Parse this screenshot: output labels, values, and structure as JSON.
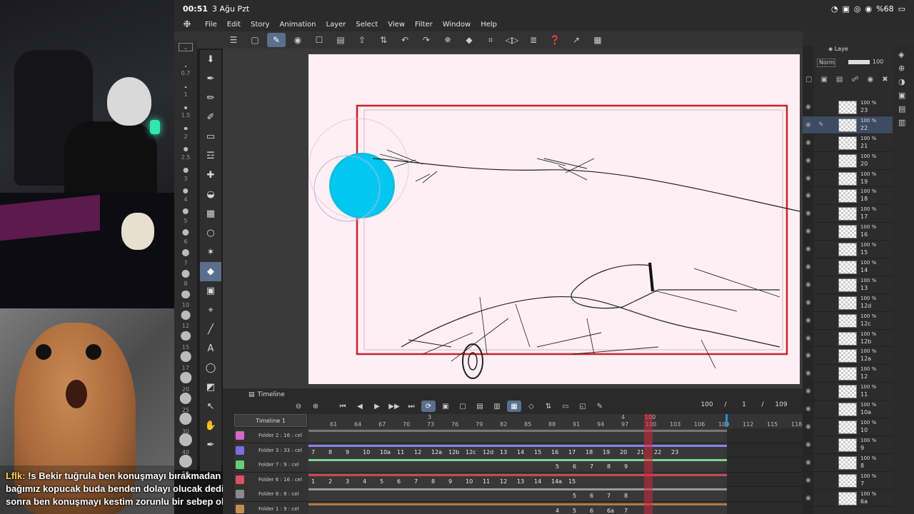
{
  "status": {
    "time": "00:51",
    "date": "3 Ağu Pzt",
    "battery": "%68"
  },
  "menu": [
    "File",
    "Edit",
    "Story",
    "Animation",
    "Layer",
    "Select",
    "View",
    "Filter",
    "Window",
    "Help"
  ],
  "brush_sizes": [
    "0.7",
    "1",
    "1.5",
    "2",
    "2.5",
    "3",
    "4",
    "5",
    "6",
    "7",
    "8",
    "10",
    "12",
    "15",
    "17",
    "20",
    "25",
    "30",
    "40",
    "50"
  ],
  "chat": {
    "user": "Lflk:",
    "message": "!s Bekir tuğrula ben konuşmayı bırakmadan önce bir gün bağımız kopucak buda benden dolayı olucak dedim iki gün sonra ben konuşmayı kestim zorunlu bir sebep olsa da"
  },
  "timeline": {
    "panel_title": "Timeline",
    "name": "Timeline 1",
    "counter": [
      "100",
      "/",
      "1",
      "/",
      "109"
    ],
    "ruler_top": [
      "3",
      "4",
      "100"
    ],
    "ruler": [
      "61",
      "64",
      "67",
      "70",
      "73",
      "76",
      "79",
      "82",
      "85",
      "88",
      "91",
      "94",
      "97",
      "100",
      "103",
      "106",
      "109",
      "112",
      "115",
      "118"
    ],
    "tracks": [
      {
        "label": "Folder 2 : 16 : cel",
        "color": "#d966c9",
        "bar": "#777777",
        "cells": []
      },
      {
        "label": "Folder 3 : 33 : cel",
        "color": "#7a6fe0",
        "bar": "#8b84e8",
        "cells": [
          "7",
          "8",
          "9",
          "10",
          "10a",
          "11",
          "12",
          "12a",
          "12b",
          "12c",
          "12d",
          "13",
          "14",
          "15",
          "16",
          "17",
          "18",
          "19",
          "20",
          "21",
          "22",
          "23"
        ]
      },
      {
        "label": "Folder 7 : 9 : cel",
        "color": "#5fd07a",
        "bar": "#7ad68f",
        "cells": [
          "5",
          "6",
          "7",
          "8",
          "9"
        ]
      },
      {
        "label": "Folder 6 : 16 : cel",
        "color": "#d9545f",
        "bar": "#c94a55",
        "cells": [
          "1",
          "2",
          "3",
          "4",
          "5",
          "6",
          "7",
          "8",
          "9",
          "10",
          "11",
          "12",
          "13",
          "14",
          "14a",
          "15"
        ]
      },
      {
        "label": "Folder 8 : 8 : cel",
        "color": "#8a8a8a",
        "bar": "#999999",
        "cells": [
          "5",
          "6",
          "7",
          "8"
        ]
      },
      {
        "label": "Folder 1 : 9 : cel",
        "color": "#c78a52",
        "bar": "#b07a48",
        "cells": [
          "4",
          "5",
          "6",
          "6a",
          "7"
        ]
      }
    ]
  },
  "layers_panel": {
    "tab": "Laye",
    "blend": "Norm",
    "opacity": "100",
    "layers": [
      {
        "opacity": "100 %",
        "name": "23"
      },
      {
        "opacity": "100 %",
        "name": "22",
        "selected": true
      },
      {
        "opacity": "100 %",
        "name": "21"
      },
      {
        "opacity": "100 %",
        "name": "20"
      },
      {
        "opacity": "100 %",
        "name": "19"
      },
      {
        "opacity": "100 %",
        "name": "18"
      },
      {
        "opacity": "100 %",
        "name": "17"
      },
      {
        "opacity": "100 %",
        "name": "16"
      },
      {
        "opacity": "100 %",
        "name": "15"
      },
      {
        "opacity": "100 %",
        "name": "14"
      },
      {
        "opacity": "100 %",
        "name": "13"
      },
      {
        "opacity": "100 %",
        "name": "12d"
      },
      {
        "opacity": "100 %",
        "name": "12c"
      },
      {
        "opacity": "100 %",
        "name": "12b"
      },
      {
        "opacity": "100 %",
        "name": "12a"
      },
      {
        "opacity": "100 %",
        "name": "12"
      },
      {
        "opacity": "100 %",
        "name": "11"
      },
      {
        "opacity": "100 %",
        "name": "10a"
      },
      {
        "opacity": "100 %",
        "name": "10"
      },
      {
        "opacity": "100 %",
        "name": "9"
      },
      {
        "opacity": "100 %",
        "name": "8"
      },
      {
        "opacity": "100 %",
        "name": "7"
      },
      {
        "opacity": "100 %",
        "name": "6a"
      }
    ]
  }
}
